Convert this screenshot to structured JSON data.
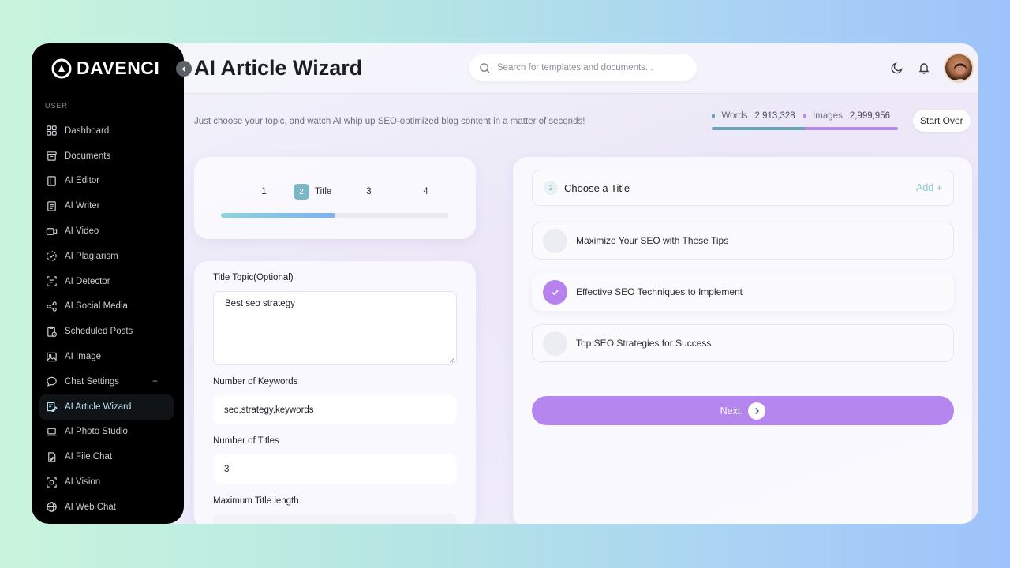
{
  "app": {
    "brand": "DAVENCI"
  },
  "sidebar": {
    "section_label": "USER",
    "items": [
      {
        "label": "Dashboard",
        "icon": "grid-icon"
      },
      {
        "label": "Documents",
        "icon": "archive-icon"
      },
      {
        "label": "AI Editor",
        "icon": "book-icon"
      },
      {
        "label": "AI Writer",
        "icon": "document-icon"
      },
      {
        "label": "AI Video",
        "icon": "video-icon"
      },
      {
        "label": "AI Plagiarism",
        "icon": "badge-check-icon"
      },
      {
        "label": "AI Detector",
        "icon": "scan-text-icon"
      },
      {
        "label": "AI Social Media",
        "icon": "share-icon"
      },
      {
        "label": "Scheduled Posts",
        "icon": "clipboard-clock-icon"
      },
      {
        "label": "AI Image",
        "icon": "image-icon"
      },
      {
        "label": "Chat Settings",
        "icon": "chat-icon"
      },
      {
        "label": "AI Article Wizard",
        "icon": "article-edit-icon"
      },
      {
        "label": "AI Photo Studio",
        "icon": "laptop-icon"
      },
      {
        "label": "AI File Chat",
        "icon": "file-edit-icon"
      },
      {
        "label": "AI Vision",
        "icon": "vision-scan-icon"
      },
      {
        "label": "AI Web Chat",
        "icon": "globe-icon"
      }
    ],
    "chat_settings_plus": "+"
  },
  "header": {
    "title": "AI Article Wizard",
    "search_placeholder": "Search for templates and documents..."
  },
  "intro": {
    "subtitle": "Just choose your topic, and watch AI whip up SEO-optimized blog content in a matter of seconds!",
    "words_label": "Words",
    "words_value": "2,913,328",
    "images_label": "Images",
    "images_value": "2,999,956",
    "start_over": "Start Over"
  },
  "steps": {
    "items": [
      "1",
      "2",
      "3",
      "4"
    ],
    "active_label": "Title",
    "progress": 0.5
  },
  "form": {
    "topic_label": "Title Topic(Optional)",
    "topic_value": "Best seo strategy",
    "keywords_label": "Number of Keywords",
    "keywords_value": "seo,strategy,keywords",
    "titles_label": "Number of Titles",
    "titles_value": "3",
    "max_length_label": "Maximum Title length"
  },
  "titles_panel": {
    "step_chip": "2",
    "heading": "Choose a Title",
    "add_label": "Add +",
    "options": [
      {
        "text": "Maximize Your SEO with These Tips",
        "selected": false
      },
      {
        "text": "Effective SEO Techniques to Implement",
        "selected": true
      },
      {
        "text": "Top SEO Strategies for Success",
        "selected": false
      }
    ],
    "next_label": "Next"
  },
  "colors": {
    "accent_purple": "#b686ef",
    "accent_teal": "#7ab6c6",
    "sidebar_bg": "#000000"
  }
}
